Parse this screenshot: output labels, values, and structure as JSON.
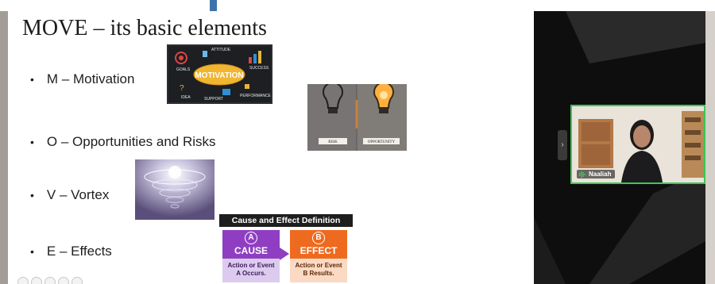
{
  "slide": {
    "title": "MOVE – its basic elements",
    "bullets": [
      {
        "label": "M – Motivation"
      },
      {
        "label": "O – Opportunities and Risks"
      },
      {
        "label": "V – Vortex"
      },
      {
        "label": "E – Effects"
      }
    ],
    "motivation_image": {
      "center_word": "MOTIVATION",
      "words": [
        "GOALS",
        "ATTITUDE",
        "SUCCESS",
        "IDEA",
        "SUPPORT",
        "PERFORMANCE"
      ]
    },
    "risk_image": {
      "left_label": "RISK",
      "right_label": "OPPORTUNITY"
    },
    "cause_effect": {
      "header": "Cause and Effect Definition",
      "cause": {
        "letter": "A",
        "title": "CAUSE",
        "line1": "Action or Event",
        "line2": "A Occurs."
      },
      "effect": {
        "letter": "B",
        "title": "EFFECT",
        "line1": "Action or Event",
        "line2": "B Results."
      }
    }
  },
  "video": {
    "participant_name": "Naaliah",
    "tile_border_color": "#3fc657"
  },
  "colors": {
    "cause_purple": "#8f3ec2",
    "effect_orange": "#ee6a1f"
  },
  "icons": [
    "mic-icon",
    "collapse-chevron-icon"
  ]
}
